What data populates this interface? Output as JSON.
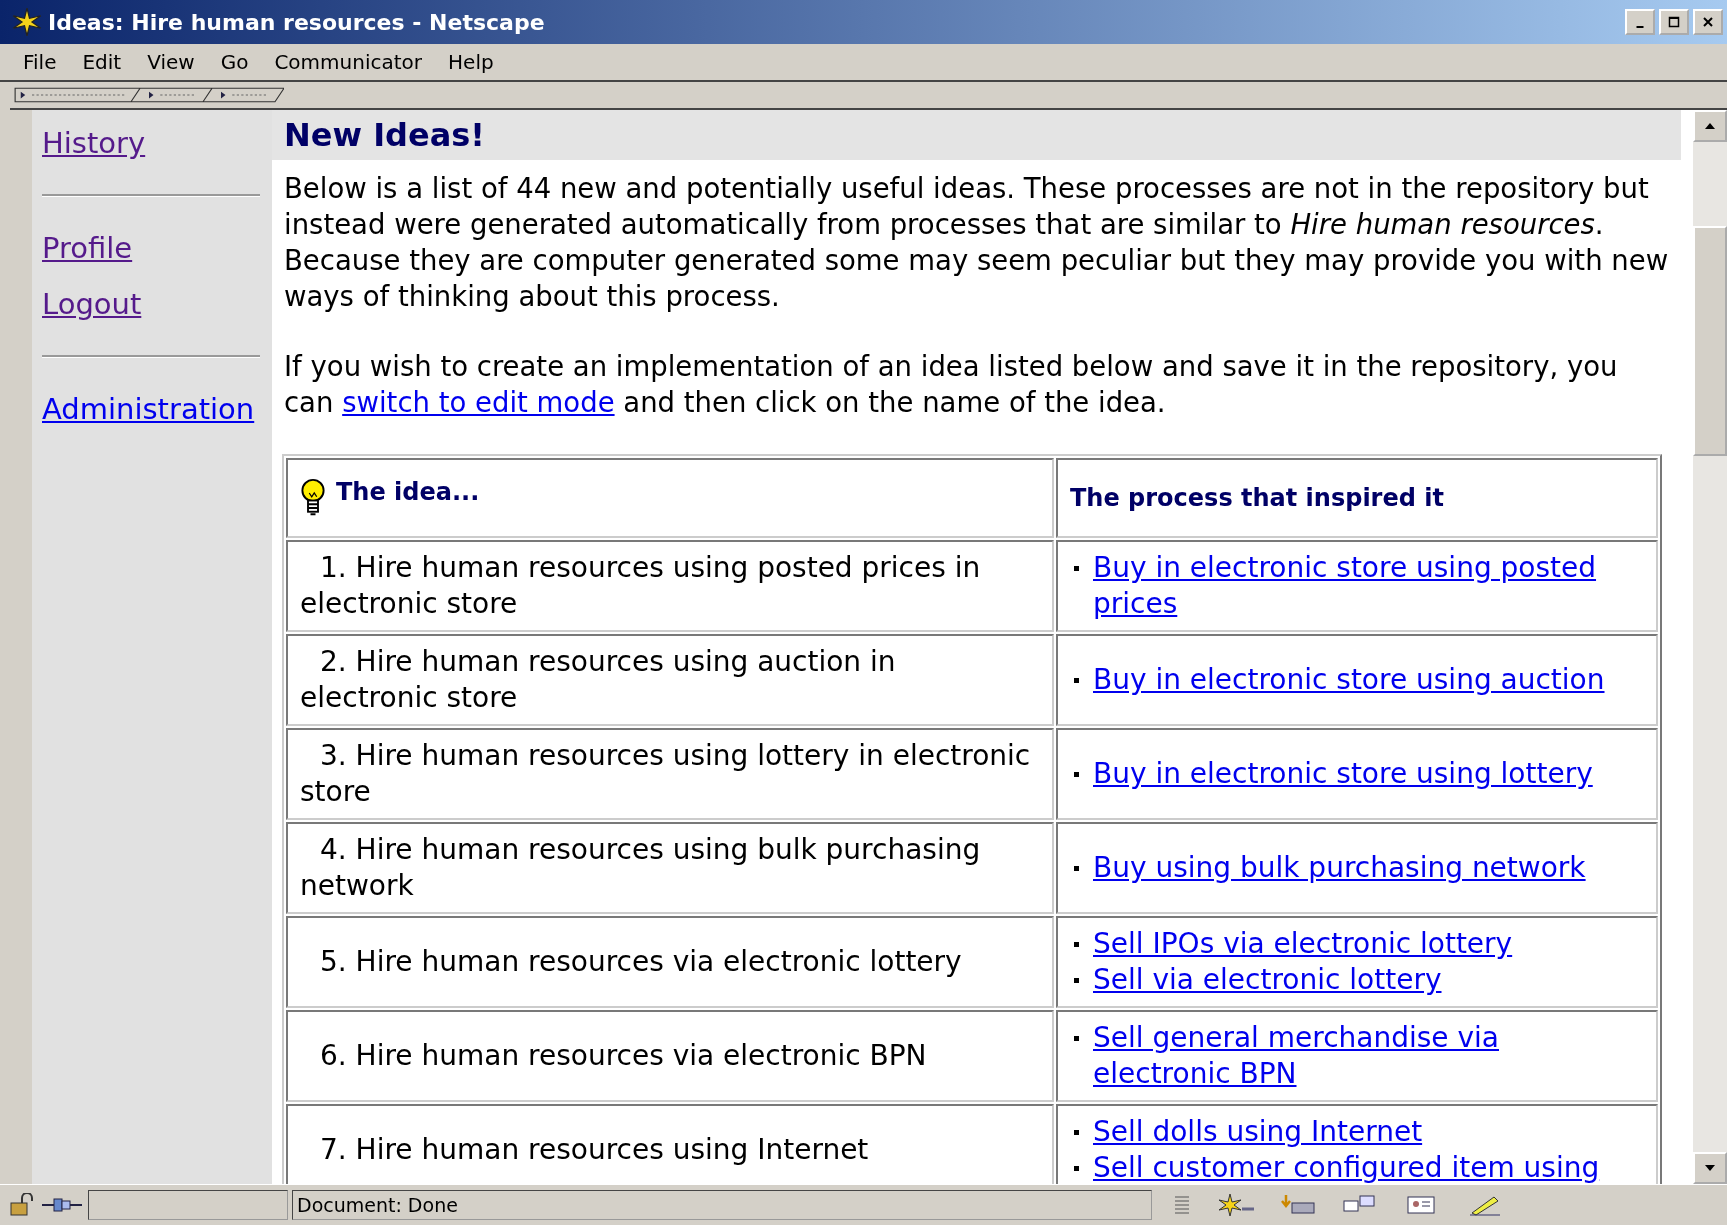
{
  "window": {
    "title": "Ideas: Hire human resources - Netscape"
  },
  "menu": [
    "File",
    "Edit",
    "View",
    "Go",
    "Communicator",
    "Help"
  ],
  "sidebar": {
    "groups": [
      [
        {
          "label": "History",
          "visited": true
        }
      ],
      [
        {
          "label": "Profile",
          "visited": true
        },
        {
          "label": "Logout",
          "visited": true
        }
      ],
      [
        {
          "label": "Administration",
          "visited": false
        }
      ]
    ]
  },
  "heading": "New Ideas!",
  "intro": "Below is a list of 44 new and potentially useful ideas. These processes are not in the repository but instead were generated automatically from processes that are similar to *Hire human resources*. Because they are computer generated some may seem peculiar but they may provide you with new ways of thinking about this process.",
  "edit_note": {
    "before": "If you wish to create an implementation of an idea listed below and save it in the repository, you can ",
    "link": "switch to edit mode",
    "after": " and then click on the name of the idea."
  },
  "table": {
    "columns": [
      "The idea...",
      "The process that inspired it"
    ],
    "rows": [
      {
        "idea": "1. Hire human resources using posted prices in electronic store",
        "processes": [
          "Buy in electronic store using posted prices"
        ]
      },
      {
        "idea": "2. Hire human resources using auction in electronic store",
        "processes": [
          "Buy in electronic store using auction"
        ]
      },
      {
        "idea": "3. Hire human resources using lottery in electronic store",
        "processes": [
          "Buy in electronic store using lottery"
        ]
      },
      {
        "idea": "4. Hire human resources using bulk purchasing network",
        "processes": [
          "Buy using bulk purchasing network"
        ]
      },
      {
        "idea": "5. Hire human resources via electronic lottery",
        "processes": [
          "Sell IPOs via electronic lottery",
          "Sell via electronic lottery"
        ]
      },
      {
        "idea": "6. Hire human resources via electronic BPN",
        "processes": [
          "Sell general merchandise via electronic BPN"
        ]
      },
      {
        "idea": "7. Hire human resources using Internet",
        "processes": [
          "Sell dolls using Internet",
          "Sell customer configured item using"
        ]
      }
    ]
  },
  "status_bar": {
    "text": "Document: Done"
  }
}
